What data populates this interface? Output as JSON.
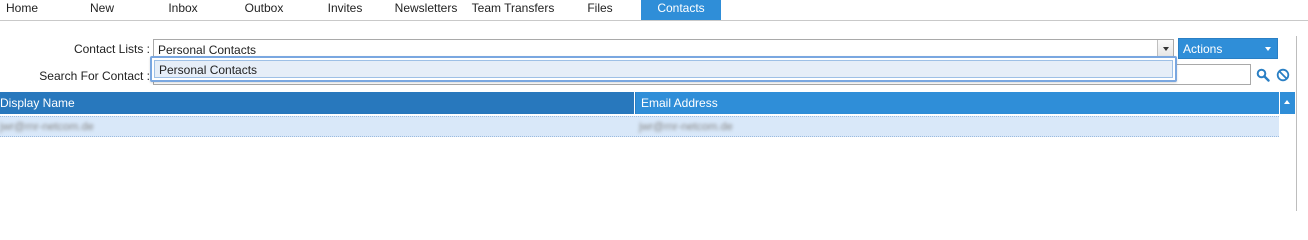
{
  "nav": {
    "tabs": [
      {
        "label": "Home",
        "active": false
      },
      {
        "label": "New",
        "active": false
      },
      {
        "label": "Inbox",
        "active": false
      },
      {
        "label": "Outbox",
        "active": false
      },
      {
        "label": "Invites",
        "active": false
      },
      {
        "label": "Newsletters",
        "active": false
      },
      {
        "label": "Team Transfers",
        "active": false
      },
      {
        "label": "Files",
        "active": false
      },
      {
        "label": "Contacts",
        "active": true
      }
    ]
  },
  "form": {
    "contact_lists_label": "Contact Lists :",
    "contact_lists_value": "Personal Contacts",
    "search_label": "Search For Contact :",
    "search_value": ""
  },
  "dropdown": {
    "options": [
      "Personal Contacts"
    ]
  },
  "actions": {
    "label": "Actions"
  },
  "grid": {
    "columns": [
      "Display Name",
      "Email Address"
    ],
    "rows": [
      {
        "display_name": "jwr@rnr-netcom.de",
        "email": "jwr@rnr-netcom.de"
      }
    ]
  },
  "colors": {
    "accent": "#2f8ed8",
    "header_dark": "#2878bd",
    "row_selected": "#d9e8f9"
  }
}
